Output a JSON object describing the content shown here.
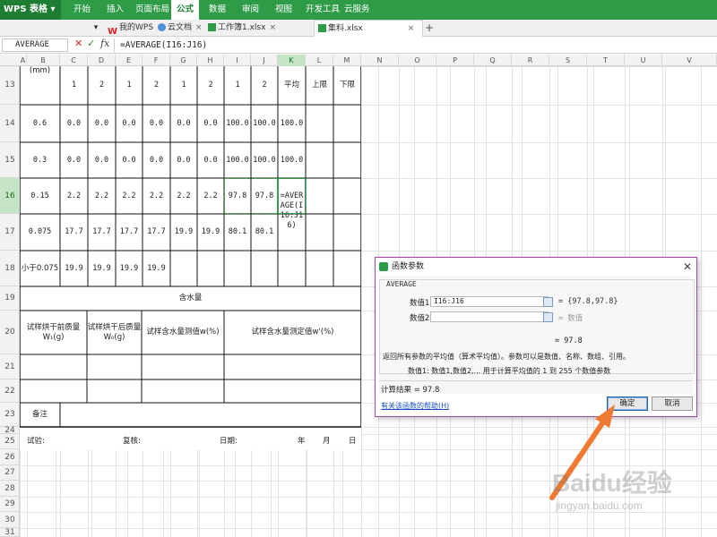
{
  "app": {
    "name": "WPS 表格"
  },
  "menu": [
    "开始",
    "插入",
    "页面布局",
    "公式",
    "数据",
    "审阅",
    "视图",
    "开发工具",
    "云服务"
  ],
  "active_menu": "公式",
  "tabs": [
    {
      "label": "我的WPS"
    },
    {
      "label": "云文档"
    },
    {
      "label": "工作簿1.xlsx"
    },
    {
      "label": "集料.xlsx"
    }
  ],
  "formula_bar": {
    "name_box": "AVERAGE",
    "fx": "fx",
    "formula": "=AVERAGE(I16:J16)"
  },
  "columns": [
    "A",
    "B",
    "C",
    "D",
    "E",
    "F",
    "G",
    "H",
    "I",
    "J",
    "K",
    "L",
    "M",
    "N",
    "O",
    "P",
    "Q",
    "R",
    "S",
    "T",
    "U",
    "V"
  ],
  "active_column": "K",
  "rows": [
    "13",
    "14",
    "15",
    "16",
    "17",
    "18",
    "19",
    "20",
    "21",
    "22",
    "23",
    "24",
    "25",
    "26",
    "27",
    "28",
    "29",
    "30",
    "31"
  ],
  "active_row": "16",
  "sheet": {
    "unit_label": "(mm)",
    "header_row": [
      "1",
      "2",
      "1",
      "2",
      "1",
      "2",
      "1",
      "2",
      "平均",
      "上限",
      "下限"
    ],
    "data_rows": [
      {
        "size": "0.6",
        "values": [
          "0.0",
          "0.0",
          "0.0",
          "0.0",
          "0.0",
          "0.0",
          "100.0",
          "100.0",
          "100.0"
        ]
      },
      {
        "size": "0.3",
        "values": [
          "0.0",
          "0.0",
          "0.0",
          "0.0",
          "0.0",
          "0.0",
          "100.0",
          "100.0",
          "100.0"
        ]
      },
      {
        "size": "0.15",
        "values": [
          "2.2",
          "2.2",
          "2.2",
          "2.2",
          "2.2",
          "2.2",
          "97.8",
          "97.8"
        ],
        "edit_text": "=AVERAGE(I16:J16)"
      },
      {
        "size": "0.075",
        "values": [
          "17.7",
          "17.7",
          "17.7",
          "17.7",
          "19.9",
          "19.9",
          "80.1",
          "80.1"
        ]
      },
      {
        "size": "小于0.075",
        "values": [
          "19.9",
          "19.9",
          "19.9",
          "19.9"
        ]
      }
    ],
    "moisture_title": "含水量",
    "moisture_headers": [
      "试样烘干前质量W₁(g)",
      "试样烘干后质量W₀(g)",
      "试样含水量测值w(%)",
      "试样含水量测定值w'(%)"
    ],
    "remarks_label": "备注",
    "footer": [
      "试验:",
      "复核:",
      "日期:",
      "年",
      "月",
      "日"
    ]
  },
  "dialog": {
    "title": "函数参数",
    "function_name": "AVERAGE",
    "args": [
      {
        "label": "数值1",
        "value": "I16:J16",
        "result": "= {97.8,97.8}"
      },
      {
        "label": "数值2",
        "value": "",
        "result": "= 数值"
      }
    ],
    "result": "= 97.8",
    "description": "返回所有参数的平均值（算术平均值）。参数可以是数值、名称、数组、引用。",
    "arg_description": "数值1:   数值1,数值2,... 用于计算平均值的 1 到 255 个数值参数",
    "calc_result": "计算结果 = 97.8",
    "help_link": "有关该函数的帮助(H)",
    "ok_label": "确定",
    "cancel_label": "取消"
  },
  "watermark": {
    "main": "Baidu经验",
    "sub": "jingyan.baidu.com"
  },
  "colors": {
    "brand": "#2e9b46",
    "selection": "#c6e5c6",
    "dialog_border": "#a648a6",
    "arrow": "#f07a32",
    "link": "#1a4ec0"
  }
}
